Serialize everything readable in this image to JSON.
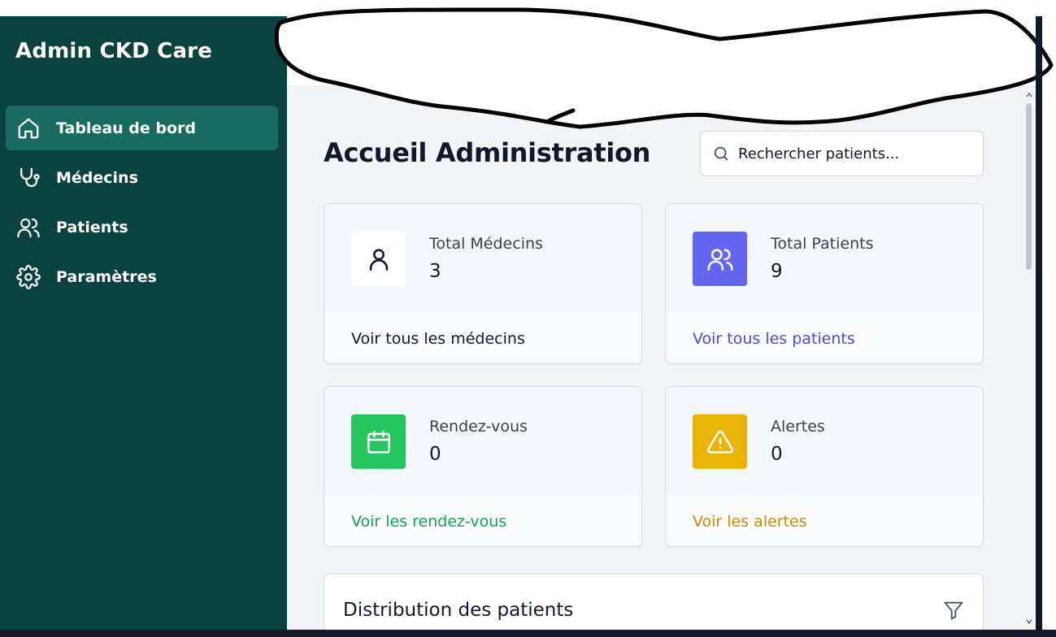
{
  "sidebar": {
    "brand": "Admin CKD Care",
    "items": [
      {
        "label": "Tableau de bord",
        "icon": "home-icon",
        "active": true
      },
      {
        "label": "Médecins",
        "icon": "stethoscope-icon",
        "active": false
      },
      {
        "label": "Patients",
        "icon": "users-icon",
        "active": false
      },
      {
        "label": "Paramètres",
        "icon": "gear-icon",
        "active": false
      }
    ]
  },
  "main": {
    "title": "Accueil Administration",
    "search": {
      "placeholder": "Rechercher patients...",
      "value": ""
    },
    "cards": [
      {
        "label": "Total Médecins",
        "value": "3",
        "link": "Voir tous les médecins",
        "icon": "user-icon",
        "icon_bg": "#ffffff",
        "link_color": "#111827"
      },
      {
        "label": "Total Patients",
        "value": "9",
        "link": "Voir tous les patients",
        "icon": "users-icon",
        "icon_bg": "#6366f1",
        "link_color": "#4f46e5"
      },
      {
        "label": "Rendez-vous",
        "value": "0",
        "link": "Voir les rendez-vous",
        "icon": "calendar-icon",
        "icon_bg": "#22c55e",
        "link_color": "#16a34a"
      },
      {
        "label": "Alertes",
        "value": "0",
        "link": "Voir les alertes",
        "icon": "warning-icon",
        "icon_bg": "#eab308",
        "link_color": "#ca8a04"
      }
    ],
    "distribution": {
      "title": "Distribution des patients",
      "icon": "filter-icon"
    }
  },
  "colors": {
    "sidebar_bg": "#0a4240",
    "sidebar_active": "#176b61",
    "page_bg": "#f3f4f6"
  }
}
